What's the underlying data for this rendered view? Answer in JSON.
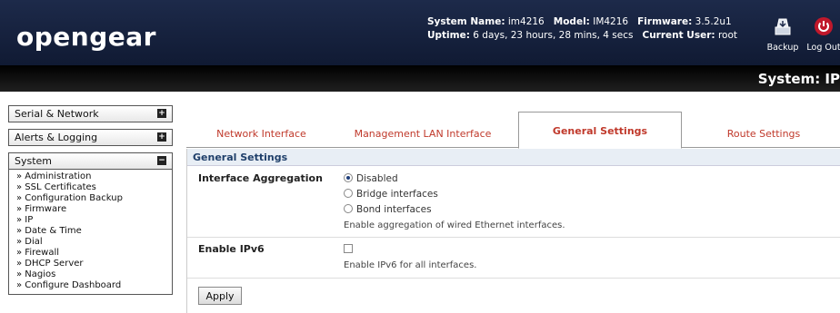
{
  "header": {
    "logo": "opengear",
    "system_name_label": "System Name:",
    "system_name": "im4216",
    "model_label": "Model:",
    "model": "IM4216",
    "firmware_label": "Firmware:",
    "firmware": "3.5.2u1",
    "uptime_label": "Uptime:",
    "uptime": "6 days, 23 hours, 28 mins, 4 secs",
    "current_user_label": "Current User:",
    "current_user": "root",
    "backup_label": "Backup",
    "logout_label": "Log Out",
    "backup_icon": "backup-icon",
    "logout_icon": "power-icon"
  },
  "page_title": "System: IP",
  "sidebar": {
    "groups": [
      {
        "label": "Serial & Network",
        "toggle": "+"
      },
      {
        "label": "Alerts & Logging",
        "toggle": "+"
      },
      {
        "label": "System",
        "toggle": "−"
      }
    ],
    "system_items": [
      "» Administration",
      "» SSL Certificates",
      "» Configuration Backup",
      "» Firmware",
      "» IP",
      "» Date & Time",
      "» Dial",
      "» Firewall",
      "» DHCP Server",
      "» Nagios",
      "» Configure Dashboard"
    ]
  },
  "tabs": [
    {
      "label": "Network Interface",
      "active": false
    },
    {
      "label": "Management LAN Interface",
      "active": false
    },
    {
      "label": "General Settings",
      "active": true
    },
    {
      "label": "Route Settings",
      "active": false
    }
  ],
  "section": {
    "title": "General Settings",
    "aggregation_label": "Interface Aggregation",
    "aggregation_options": [
      {
        "label": "Disabled",
        "selected": true
      },
      {
        "label": "Bridge interfaces",
        "selected": false
      },
      {
        "label": "Bond interfaces",
        "selected": false
      }
    ],
    "aggregation_help": "Enable aggregation of wired Ethernet interfaces.",
    "ipv6_label": "Enable IPv6",
    "ipv6_checked": false,
    "ipv6_help": "Enable IPv6 for all interfaces.",
    "apply_label": "Apply"
  },
  "colors": {
    "header_bg": "#1d2a4a",
    "tab_text": "#c0392b",
    "section_title": "#1f3f6a",
    "logout_red": "#c0182b"
  }
}
